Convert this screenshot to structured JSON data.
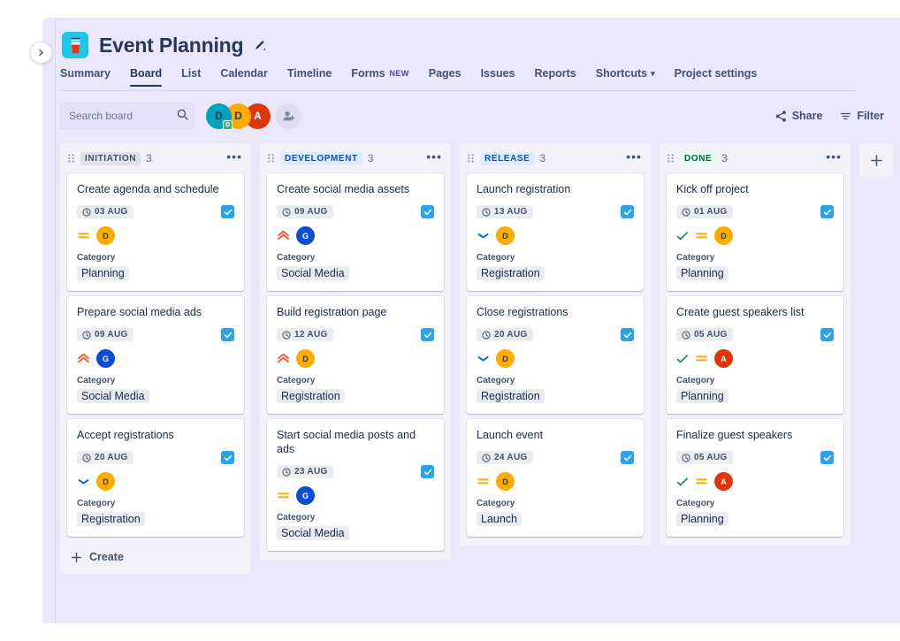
{
  "header": {
    "project_title": "Event Planning",
    "project_icon": "coffee-cup-icon",
    "edit_icon": "edit-pencil-icon",
    "collapse_icon": "chevron-right-icon",
    "accent_icon_bg": "#1fc6e8"
  },
  "nav": {
    "tabs": [
      {
        "label": "Summary",
        "active": false
      },
      {
        "label": "Board",
        "active": true
      },
      {
        "label": "List",
        "active": false
      },
      {
        "label": "Calendar",
        "active": false
      },
      {
        "label": "Timeline",
        "active": false
      },
      {
        "label": "Forms",
        "active": false,
        "badge": "NEW"
      },
      {
        "label": "Pages",
        "active": false
      },
      {
        "label": "Issues",
        "active": false
      },
      {
        "label": "Reports",
        "active": false
      },
      {
        "label": "Shortcuts",
        "active": false,
        "caret": "⌄"
      },
      {
        "label": "Project settings",
        "active": false
      }
    ]
  },
  "toolbar": {
    "search_placeholder": "Search board",
    "search_value": "",
    "search_icon": "magnifier-icon",
    "avatars": [
      {
        "initial": "D",
        "bg": "#00a3bf",
        "badge": "D"
      },
      {
        "initial": "D",
        "bg": "#ffab00",
        "badge": null
      },
      {
        "initial": "A",
        "bg": "#de350b",
        "badge": null,
        "fg": "#ffffff"
      }
    ],
    "add_people_icon": "add-person-icon",
    "share_label": "Share",
    "share_icon": "share-icon",
    "filter_label": "Filter",
    "filter_icon": "filter-icon"
  },
  "board": {
    "add_column_icon": "plus-icon",
    "create_label": "Create",
    "create_icon": "plus-icon",
    "columns": [
      {
        "name": "INITIATION",
        "count": "3",
        "chip_bg": "#dfe1e6",
        "chip_fg": "#42526e",
        "more_icon": "more-horizontal-icon",
        "grip_icon": "drag-handle-icon",
        "show_create": true,
        "cards": [
          {
            "title": "Create agenda and schedule",
            "date": "03 AUG",
            "date_icon": "clock-icon",
            "type_icon": "task-checkbox-icon",
            "done": false,
            "priority": "medium",
            "assignee": {
              "initial": "D",
              "bg": "#ffab00",
              "fg": "#253858"
            },
            "field_label": "Category",
            "field_value": "Planning"
          },
          {
            "title": "Prepare social media ads",
            "date": "09 AUG",
            "date_icon": "clock-icon",
            "type_icon": "task-checkbox-icon",
            "done": false,
            "priority": "high",
            "assignee": {
              "initial": "G",
              "bg": "#0b4ed4",
              "fg": "#ffffff"
            },
            "field_label": "Category",
            "field_value": "Social Media"
          },
          {
            "title": "Accept registrations",
            "date": "20 AUG",
            "date_icon": "clock-icon",
            "type_icon": "task-checkbox-icon",
            "done": false,
            "priority": "low",
            "assignee": {
              "initial": "D",
              "bg": "#ffab00",
              "fg": "#253858"
            },
            "field_label": "Category",
            "field_value": "Registration"
          }
        ]
      },
      {
        "name": "DEVELOPMENT",
        "count": "3",
        "chip_bg": "#deebff",
        "chip_fg": "#0052cc",
        "more_icon": "more-horizontal-icon",
        "grip_icon": "drag-handle-icon",
        "show_create": false,
        "cards": [
          {
            "title": "Create social media assets",
            "date": "09 AUG",
            "date_icon": "clock-icon",
            "type_icon": "task-checkbox-icon",
            "done": false,
            "priority": "high",
            "assignee": {
              "initial": "G",
              "bg": "#0b4ed4",
              "fg": "#ffffff"
            },
            "field_label": "Category",
            "field_value": "Social Media"
          },
          {
            "title": "Build registration page",
            "date": "12 AUG",
            "date_icon": "clock-icon",
            "type_icon": "task-checkbox-icon",
            "done": false,
            "priority": "high",
            "assignee": {
              "initial": "D",
              "bg": "#ffab00",
              "fg": "#253858"
            },
            "field_label": "Category",
            "field_value": "Registration"
          },
          {
            "title": "Start social media posts and ads",
            "date": "23 AUG",
            "date_icon": "clock-icon",
            "type_icon": "task-checkbox-icon",
            "done": false,
            "priority": "medium",
            "assignee": {
              "initial": "G",
              "bg": "#0b4ed4",
              "fg": "#ffffff"
            },
            "field_label": "Category",
            "field_value": "Social Media"
          }
        ]
      },
      {
        "name": "RELEASE",
        "count": "3",
        "chip_bg": "#deebff",
        "chip_fg": "#0052cc",
        "more_icon": "more-horizontal-icon",
        "grip_icon": "drag-handle-icon",
        "show_create": false,
        "cards": [
          {
            "title": "Launch registration",
            "date": "13 AUG",
            "date_icon": "clock-icon",
            "type_icon": "task-checkbox-icon",
            "done": false,
            "priority": "low",
            "assignee": {
              "initial": "D",
              "bg": "#ffab00",
              "fg": "#253858"
            },
            "field_label": "Category",
            "field_value": "Registration"
          },
          {
            "title": "Close registrations",
            "date": "20 AUG",
            "date_icon": "clock-icon",
            "type_icon": "task-checkbox-icon",
            "done": false,
            "priority": "low",
            "assignee": {
              "initial": "D",
              "bg": "#ffab00",
              "fg": "#253858"
            },
            "field_label": "Category",
            "field_value": "Registration"
          },
          {
            "title": "Launch event",
            "date": "24 AUG",
            "date_icon": "clock-icon",
            "type_icon": "task-checkbox-icon",
            "done": false,
            "priority": "medium",
            "assignee": {
              "initial": "D",
              "bg": "#ffab00",
              "fg": "#253858"
            },
            "field_label": "Category",
            "field_value": "Launch"
          }
        ]
      },
      {
        "name": "DONE",
        "count": "3",
        "chip_bg": "#e3fcef",
        "chip_fg": "#006644",
        "more_icon": "more-horizontal-icon",
        "grip_icon": "drag-handle-icon",
        "show_create": false,
        "cards": [
          {
            "title": "Kick off project",
            "date": "01 AUG",
            "date_icon": "clock-icon",
            "type_icon": "task-checkbox-icon",
            "done": true,
            "priority": "medium",
            "assignee": {
              "initial": "D",
              "bg": "#ffab00",
              "fg": "#253858"
            },
            "field_label": "Category",
            "field_value": "Planning"
          },
          {
            "title": "Create guest speakers list",
            "date": "05 AUG",
            "date_icon": "clock-icon",
            "type_icon": "task-checkbox-icon",
            "done": true,
            "priority": "medium",
            "assignee": {
              "initial": "A",
              "bg": "#de350b",
              "fg": "#ffffff"
            },
            "field_label": "Category",
            "field_value": "Planning"
          },
          {
            "title": "Finalize guest speakers",
            "date": "05 AUG",
            "date_icon": "clock-icon",
            "type_icon": "task-checkbox-icon",
            "done": true,
            "priority": "medium",
            "assignee": {
              "initial": "A",
              "bg": "#de350b",
              "fg": "#ffffff"
            },
            "field_label": "Category",
            "field_value": "Planning"
          }
        ]
      }
    ]
  },
  "colors": {
    "canvas": "#eae7fb",
    "column": "#f2f1f7",
    "card": "#ffffff",
    "priority_high": "#ff5630",
    "priority_medium": "#ffab00",
    "priority_low": "#0065ff",
    "done_check": "#00875a",
    "issue_type": "#2aa3e8"
  }
}
